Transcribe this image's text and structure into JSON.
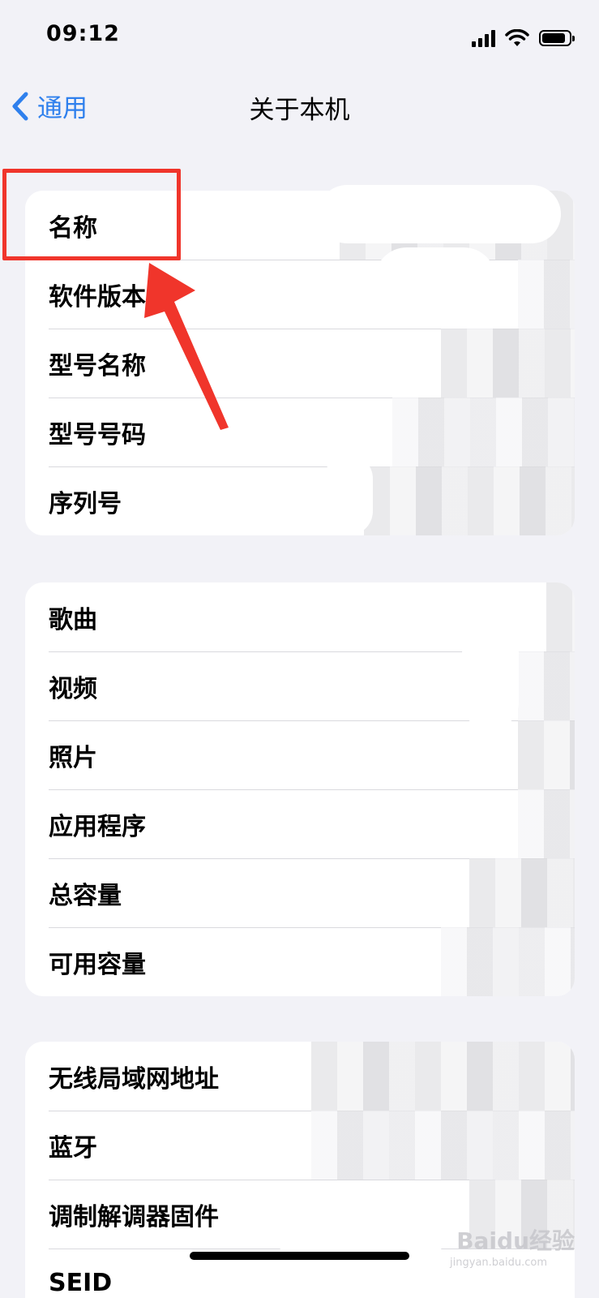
{
  "status_bar": {
    "time": "09:12",
    "battery_level": 0.9
  },
  "nav": {
    "back_label": "通用",
    "title": "关于本机"
  },
  "groups": [
    {
      "rows": [
        "名称",
        "软件版本",
        "型号名称",
        "型号号码",
        "序列号"
      ]
    },
    {
      "rows": [
        "歌曲",
        "视频",
        "照片",
        "应用程序",
        "总容量",
        "可用容量"
      ]
    },
    {
      "rows": [
        "无线局域网地址",
        "蓝牙",
        "调制解调器固件",
        "SEID"
      ]
    }
  ],
  "watermark": {
    "text": "Baidu经验",
    "sub": "jingyan.baidu.com"
  },
  "colors": {
    "accent": "#2f80ed",
    "annotation": "#f0352b",
    "background": "#f2f2f7"
  }
}
